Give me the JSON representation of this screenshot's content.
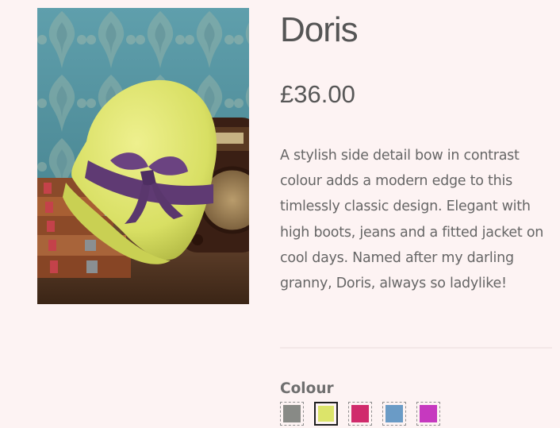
{
  "product": {
    "name": "Doris",
    "price": "£36.00",
    "description": "A stylish side detail bow in contrast colour adds a modern edge to this timlessly classic design. Elegant with high boots, jeans and a fitted jacket on cool days. Named after my darling granny, Doris, always so ladylike!",
    "image_subject": "yellow-cloche-hat-with-purple-bow"
  },
  "colour": {
    "label": "Colour",
    "swatches": [
      {
        "name": "grey",
        "color": "#888a86",
        "selected": false
      },
      {
        "name": "lime",
        "color": "#dce46a",
        "selected": true
      },
      {
        "name": "raspberry",
        "color": "#d02b6c",
        "selected": false
      },
      {
        "name": "blue",
        "color": "#6a9bc6",
        "selected": false
      },
      {
        "name": "magenta",
        "color": "#c639bf",
        "selected": false
      }
    ]
  },
  "theme": {
    "background": "#fdf3f3",
    "text": "#555555"
  }
}
